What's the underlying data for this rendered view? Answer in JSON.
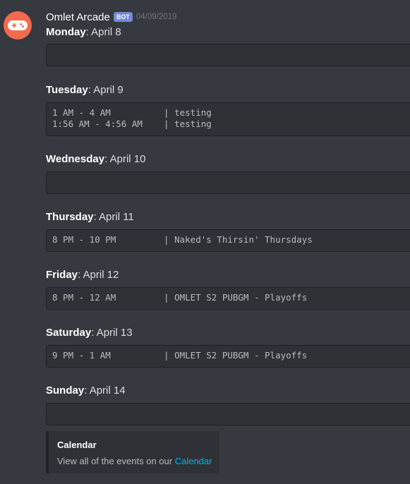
{
  "author": {
    "name": "Omlet Arcade",
    "tag": "BOT",
    "timestamp": "04/09/2019",
    "avatar_color": "#f36b4f",
    "avatar_icon": "gamepad-icon"
  },
  "days": [
    {
      "day": "Monday",
      "date": ": April 8",
      "lines": ""
    },
    {
      "day": "Tuesday",
      "date": ": April 9",
      "lines": "1 AM - 4 AM          | testing\n1:56 AM - 4:56 AM    | testing"
    },
    {
      "day": "Wednesday",
      "date": ": April 10",
      "lines": ""
    },
    {
      "day": "Thursday",
      "date": ": April 11",
      "lines": "8 PM - 10 PM         | Naked's Thirsin' Thursdays"
    },
    {
      "day": "Friday",
      "date": ": April 12",
      "lines": "8 PM - 12 AM         | OMLET S2 PUBGM - Playoffs"
    },
    {
      "day": "Saturday",
      "date": ": April 13",
      "lines": "9 PM - 1 AM          | OMLET S2 PUBGM - Playoffs"
    },
    {
      "day": "Sunday",
      "date": ": April 14",
      "lines": ""
    }
  ],
  "embed": {
    "title": "Calendar",
    "description": "View all of the events on our ",
    "link_text": "Calendar"
  },
  "colors": {
    "background": "#36393f",
    "codeblock": "#2f3136",
    "link": "#00b0f4",
    "bot_tag": "#7289da"
  }
}
